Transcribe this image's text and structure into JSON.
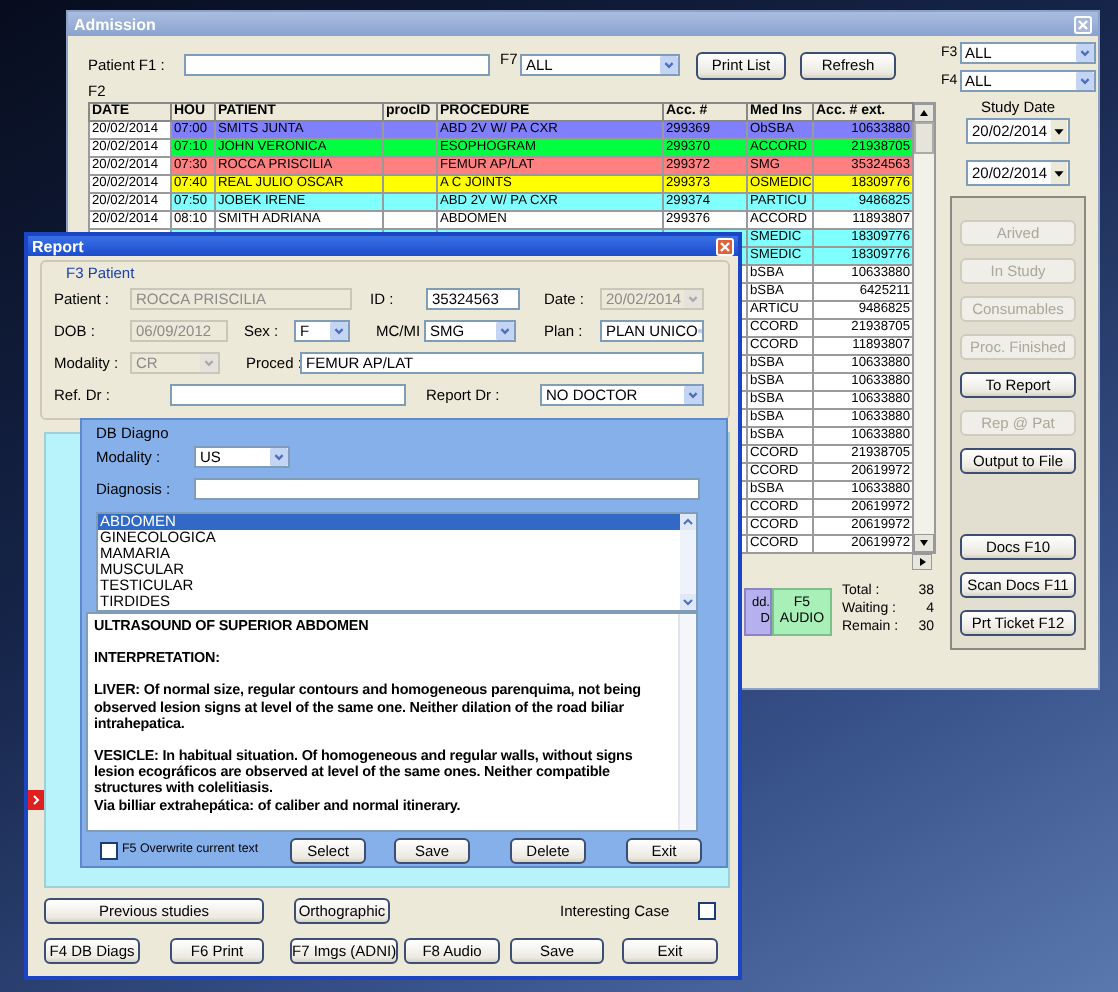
{
  "admission": {
    "title": "Admission",
    "patient_label": "Patient F1 :",
    "f7_label": "F7",
    "f7_combo": "ALL",
    "print_button": "Print List",
    "refresh_button": "Refresh",
    "f2_label": "F2",
    "table": {
      "columns": [
        "DATE",
        "HOU",
        "PATIENT",
        "procID",
        "PROCEDURE",
        "Acc. #",
        "Med Ins",
        "Acc. # ext."
      ],
      "rows": [
        {
          "date": "20/02/2014",
          "hour": "07:00",
          "patient": "SMITS JUNTA",
          "procedure": "ABD 2V W/ PA CXR",
          "acc": "299369",
          "med_ins": "ObSBA",
          "acc_ext": "10633880",
          "color": "#8080ff"
        },
        {
          "date": "20/02/2014",
          "hour": "07:10",
          "patient": "JOHN VERONICA",
          "procedure": "ESOPHOGRAM",
          "acc": "299370",
          "med_ins": "ACCORD",
          "acc_ext": "21938705",
          "color": "#00ff40"
        },
        {
          "date": "20/02/2014",
          "hour": "07:30",
          "patient": "ROCCA PRISCILIA",
          "procedure": "FEMUR AP/LAT",
          "acc": "299372",
          "med_ins": "SMG",
          "acc_ext": "35324563",
          "color": "#ff8080"
        },
        {
          "date": "20/02/2014",
          "hour": "07:40",
          "patient": "REAL JULIO OSCAR",
          "procedure": "A C JOINTS",
          "acc": "299373",
          "med_ins": "OSMEDIC",
          "acc_ext": "18309776",
          "color": "#ffff00"
        },
        {
          "date": "20/02/2014",
          "hour": "07:50",
          "patient": "JOBEK IRENE",
          "procedure": "ABD 2V W/ PA CXR",
          "acc": "299374",
          "med_ins": "PARTICU",
          "acc_ext": "9486825",
          "color": "#80ffff"
        },
        {
          "date": "20/02/2014",
          "hour": "08:10",
          "patient": "SMITH ADRIANA",
          "procedure": "ABDOMEN",
          "acc": "299376",
          "med_ins": "ACCORD",
          "acc_ext": "11893807",
          "color": "#ffffff"
        },
        {
          "med_ins": "SMEDIC",
          "acc_ext": "18309776",
          "color": "#80ffff"
        },
        {
          "med_ins": "SMEDIC",
          "acc_ext": "18309776",
          "color": "#80ffff"
        },
        {
          "med_ins": "bSBA",
          "acc_ext": "10633880",
          "color": "#ffffff"
        },
        {
          "med_ins": "bSBA",
          "acc_ext": "6425211",
          "color": "#ffffff"
        },
        {
          "med_ins": "ARTICU",
          "acc_ext": "9486825",
          "color": "#ffffff"
        },
        {
          "med_ins": "CCORD",
          "acc_ext": "21938705",
          "color": "#ffffff"
        },
        {
          "med_ins": "CCORD",
          "acc_ext": "11893807",
          "color": "#ffffff"
        },
        {
          "med_ins": "bSBA",
          "acc_ext": "10633880",
          "color": "#ffffff"
        },
        {
          "med_ins": "bSBA",
          "acc_ext": "10633880",
          "color": "#ffffff"
        },
        {
          "med_ins": "bSBA",
          "acc_ext": "10633880",
          "color": "#ffffff"
        },
        {
          "med_ins": "bSBA",
          "acc_ext": "10633880",
          "color": "#ffffff"
        },
        {
          "med_ins": "bSBA",
          "acc_ext": "10633880",
          "color": "#ffffff"
        },
        {
          "med_ins": "CCORD",
          "acc_ext": "21938705",
          "color": "#ffffff"
        },
        {
          "med_ins": "CCORD",
          "acc_ext": "20619972",
          "color": "#ffffff"
        },
        {
          "med_ins": "bSBA",
          "acc_ext": "10633880",
          "color": "#ffffff"
        },
        {
          "med_ins": "CCORD",
          "acc_ext": "20619972",
          "color": "#ffffff"
        },
        {
          "med_ins": "CCORD",
          "acc_ext": "20619972",
          "color": "#ffffff"
        },
        {
          "med_ins": "CCORD",
          "acc_ext": "20619972",
          "color": "#ffffff"
        }
      ]
    },
    "partial_button": "dd. D",
    "audio_button": "F5 AUDIO",
    "totals": [
      {
        "label": "Total :",
        "value": "38"
      },
      {
        "label": "Waiting :",
        "value": "4"
      },
      {
        "label": "Remain :",
        "value": "30"
      }
    ],
    "f3_label": "F3",
    "f3_combo": "ALL",
    "f4_label": "F4",
    "f4_combo": "ALL",
    "study_date_label": "Study Date",
    "date_from": "20/02/2014",
    "date_to": "20/02/2014",
    "actions": [
      {
        "label": "Arived",
        "disabled": true
      },
      {
        "label": "In Study",
        "disabled": true
      },
      {
        "label": "Consumables",
        "disabled": true
      },
      {
        "label": "Proc. Finished",
        "disabled": true
      },
      {
        "label": "To Report",
        "disabled": false
      },
      {
        "label": "Rep @ Pat",
        "disabled": true
      },
      {
        "label": "Output to File",
        "disabled": false
      }
    ],
    "doc_buttons": [
      "Docs F10",
      "Scan Docs F11",
      "Prt Ticket F12"
    ]
  },
  "report": {
    "title": "Report",
    "group_title": "F3 Patient",
    "patient_rows": [
      [
        {
          "label": "Patient :",
          "value": "ROCCA PRISCILIA",
          "kind": "input",
          "disabled": true
        },
        {
          "label": "ID :",
          "value": "35324563",
          "kind": "input",
          "disabled": false
        },
        {
          "label": "Date :",
          "value": "20/02/2014",
          "kind": "combo",
          "disabled": true
        }
      ],
      [
        {
          "label": "DOB :",
          "value": "06/09/2012",
          "kind": "input",
          "disabled": true
        },
        {
          "label": "Sex :",
          "value": "F",
          "kind": "combo",
          "disabled": false
        },
        {
          "label": "MC/MI",
          "value": "SMG",
          "kind": "combo",
          "disabled": false
        },
        {
          "label": "Plan :",
          "value": "PLAN UNICO",
          "kind": "combo",
          "disabled": false
        }
      ],
      [
        {
          "label": "Modality :",
          "value": "CR",
          "kind": "combo",
          "disabled": true
        },
        {
          "label": "Proced :",
          "value": "FEMUR AP/LAT",
          "kind": "input",
          "disabled": false
        }
      ],
      [
        {
          "label": "Ref. Dr :",
          "kind": "input",
          "disabled": false
        },
        {
          "label": "Report Dr :",
          "value": "NO DOCTOR",
          "kind": "combo",
          "disabled": false
        }
      ]
    ],
    "diagno": {
      "title": "DB Diagno",
      "modality_label": "Modality :",
      "modality": "US",
      "diagnosis_label": "Diagnosis :",
      "list": [
        {
          "label": "ABDOMEN",
          "selected": true
        },
        {
          "label": "GINECOLOGICA",
          "selected": false
        },
        {
          "label": "MAMARIA",
          "selected": false
        },
        {
          "label": "MUSCULAR",
          "selected": false
        },
        {
          "label": "TESTICULAR",
          "selected": false
        },
        {
          "label": "TIRDIDES",
          "selected": false
        }
      ],
      "text": [
        {
          "text": "ULTRASOUND OF SUPERIOR ABDOMEN",
          "space_before": false
        },
        {
          "text": "INTERPRETATION:",
          "space_before": true
        },
        {
          "text": "LIVER: Of normal size, regular contours and homogeneous parenquima, not being observed lesion signs at level of the same one. Neither dilation of the road biliar intrahepatica.",
          "space_before": true
        },
        {
          "text": "VESICLE: In habitual situation. Of homogeneous and regular walls, without signs lesion ecográficos are observed at level of the same ones. Neither compatible structures with colelitiasis.",
          "space_before": true
        },
        {
          "text": "Via billiar extrahepática: of caliber and normal itinerary.",
          "space_before": false
        }
      ],
      "overwrite": {
        "label": "F5 Overwrite current text",
        "checked": false
      },
      "buttons": [
        "Select",
        "Save",
        "Delete",
        "Exit"
      ]
    },
    "previous_button": "Previous studies",
    "ortho_button": "Orthographic",
    "interesting": {
      "label": "Interesting Case",
      "checked": false
    },
    "buttons": [
      "F4 DB Diags",
      "F6 Print",
      "F7 Imgs (ADNI)",
      "F8 Audio",
      "Save",
      "Exit"
    ]
  }
}
